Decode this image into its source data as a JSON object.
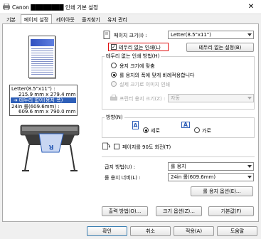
{
  "window": {
    "title": "Canon ████████ 인쇄 기본 설정",
    "close": "✕"
  },
  "tabs": [
    {
      "label": "기본"
    },
    {
      "label": "페이지 설정"
    },
    {
      "label": "레이아웃"
    },
    {
      "label": "즐겨찾기"
    },
    {
      "label": "유지 관리"
    }
  ],
  "preview": {
    "media_label": "Letter(8.5\"x11\") :",
    "media_size": "215.9 mm x 279.4 mm",
    "borderless_label": "테두리 없이(용지 폭)",
    "roll_label": "24in 롤(609.6mm) :",
    "roll_size": "609.6 mm x 790.0 mm",
    "printer_icon_letter": "R"
  },
  "page_size": {
    "label": "페이지 크기(I) :",
    "value": "Letter(8.5\"x11\")"
  },
  "borderless": {
    "label": "테두리 없는 인쇄(L)",
    "checked": true,
    "settings_button": "테두리 없는 설정(B)"
  },
  "borderless_method": {
    "title": "테두리 없는 인쇄 방법(H)",
    "options": [
      {
        "label": "용지 크기에 맞춤",
        "selected": false,
        "enabled": true
      },
      {
        "label": "롤 용지의 폭에 맞게 비례적용합니다",
        "selected": true,
        "enabled": true
      },
      {
        "label": "실제 크기로 이미지 인쇄",
        "selected": false,
        "enabled": false
      }
    ],
    "printer_paper_size_label": "프린터 용지 크기(Z) :",
    "printer_paper_size_value": "자동"
  },
  "orientation": {
    "title": "방향(N)",
    "portrait": "세로",
    "landscape": "가로",
    "portrait_selected": true,
    "rotate_label": "페이지를 90도 회전(T)"
  },
  "paper_source": {
    "label": "급지 방법(U) :",
    "value": "롤 용지"
  },
  "roll_width": {
    "label": "롤 용지 너비(L) :",
    "value": "24in 롤(609.6mm)"
  },
  "roll_options_button": "롤 용지 옵션(E)...",
  "bottom_buttons": {
    "output": "출력 방법(O)...",
    "size_options": "크기 옵션(Z)...",
    "defaults": "기본값(F)"
  },
  "dialog_buttons": {
    "ok": "확인",
    "cancel": "취소",
    "apply": "적용(A)",
    "help": "도움말"
  },
  "highlight_color": "#e01010"
}
